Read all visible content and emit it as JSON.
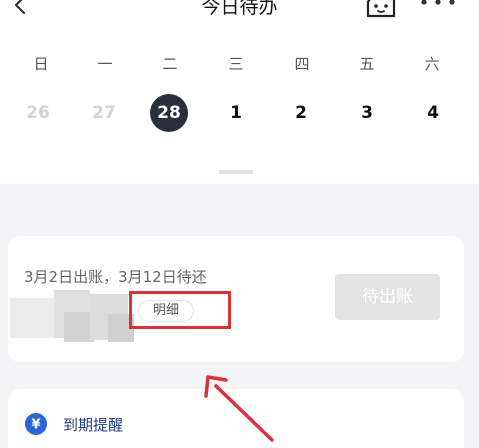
{
  "header": {
    "title": "今日待办"
  },
  "calendar": {
    "weekdays": [
      "日",
      "一",
      "二",
      "三",
      "四",
      "五",
      "六"
    ],
    "dates": [
      "26",
      "27",
      "28",
      "1",
      "2",
      "3",
      "4"
    ],
    "selected_date": "28"
  },
  "bill_card": {
    "status_text": "3月2日出账，3月12日待还",
    "detail_label": "明细",
    "pending_label": "待出账"
  },
  "reminder_card": {
    "label": "到期提醒",
    "icon_glyph": "¥"
  },
  "colors": {
    "selected_date_bg": "#2b2f3c",
    "highlight": "#d9333a",
    "reminder_icon": "#2f64d8",
    "reminder_text": "#1f3c88"
  }
}
